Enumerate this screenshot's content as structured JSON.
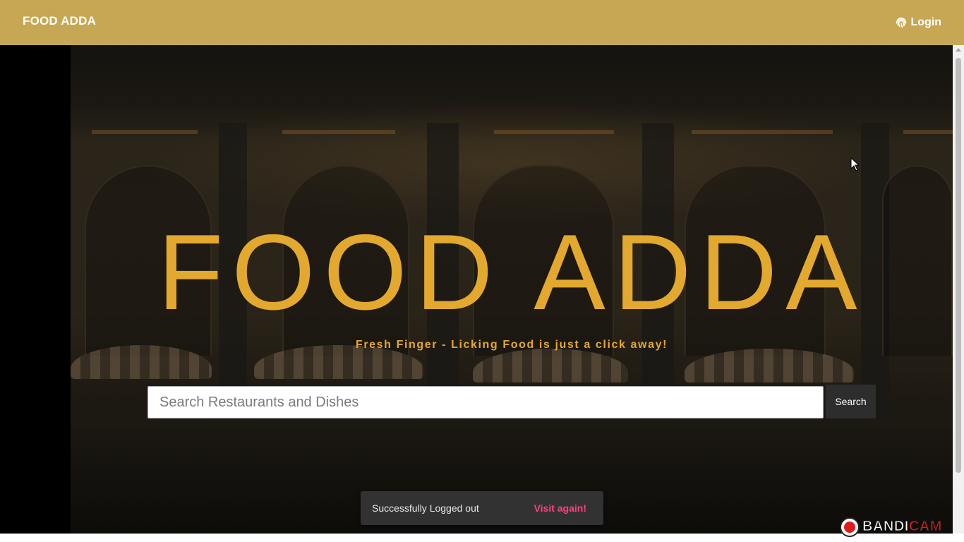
{
  "navbar": {
    "brand": "FOOD ADDA",
    "login_label": "Login",
    "login_icon": "fingerprint-icon",
    "background": "#c6a753"
  },
  "hero": {
    "title": "FOOD ADDA",
    "tagline": "Fresh Finger - Licking Food is just a click away!",
    "accent_color": "#e3a92e",
    "background_image": "dim restaurant / cafe terrace at night"
  },
  "search": {
    "placeholder": "Search Restaurants and Dishes",
    "value": "",
    "button_label": "Search"
  },
  "toast": {
    "message": "Successfully Logged out",
    "action_label": "Visit again!",
    "action_color": "#ff4081"
  },
  "watermark": {
    "prefix": "BANDI",
    "suffix": "CAM"
  }
}
